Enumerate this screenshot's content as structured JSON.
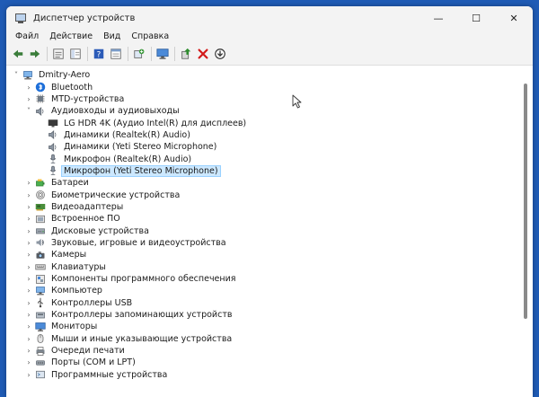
{
  "window": {
    "title": "Диспетчер устройств",
    "controls": {
      "minimize": "—",
      "maximize": "☐",
      "close": "✕"
    }
  },
  "menu": [
    "Файл",
    "Действие",
    "Вид",
    "Справка"
  ],
  "toolbar": [
    {
      "name": "back-button",
      "icon": "arrow-left-icon"
    },
    {
      "name": "forward-button",
      "icon": "arrow-right-icon"
    },
    {
      "sep": true
    },
    {
      "name": "properties-button",
      "icon": "properties-icon"
    },
    {
      "name": "show-hide-console-tree-button",
      "icon": "console-tree-icon"
    },
    {
      "sep": true
    },
    {
      "name": "help-button",
      "icon": "help-icon"
    },
    {
      "name": "driver-details-button",
      "icon": "panel-icon"
    },
    {
      "sep": true
    },
    {
      "name": "scan-hardware-button",
      "icon": "scan-icon"
    },
    {
      "sep": true
    },
    {
      "name": "monitor-button",
      "icon": "monitor-icon"
    },
    {
      "sep": true
    },
    {
      "name": "update-driver-button",
      "icon": "update-driver-icon"
    },
    {
      "name": "uninstall-button",
      "icon": "red-x-icon"
    },
    {
      "name": "disable-device-button",
      "icon": "download-circle-icon"
    }
  ],
  "tree": [
    {
      "label": "Dmitry-Aero",
      "level": 0,
      "exp": "open",
      "icon": "computer-icon"
    },
    {
      "label": "Bluetooth",
      "level": 1,
      "exp": "closed",
      "icon": "bluetooth-icon"
    },
    {
      "label": "MTD-устройства",
      "level": 1,
      "exp": "closed",
      "icon": "chip-icon"
    },
    {
      "label": "Аудиовходы и аудиовыходы",
      "level": 1,
      "exp": "open",
      "icon": "speaker-icon"
    },
    {
      "label": "LG HDR 4K (Аудио Intel(R) для дисплеев)",
      "level": 2,
      "exp": "none",
      "icon": "display-audio-icon"
    },
    {
      "label": "Динамики (Realtek(R) Audio)",
      "level": 2,
      "exp": "none",
      "icon": "speaker-icon"
    },
    {
      "label": "Динамики (Yeti Stereo Microphone)",
      "level": 2,
      "exp": "none",
      "icon": "speaker-icon"
    },
    {
      "label": "Микрофон (Realtek(R) Audio)",
      "level": 2,
      "exp": "none",
      "icon": "microphone-icon"
    },
    {
      "label": "Микрофон (Yeti Stereo Microphone)",
      "level": 2,
      "exp": "none",
      "icon": "microphone-icon",
      "selected": true
    },
    {
      "label": "Батареи",
      "level": 1,
      "exp": "closed",
      "icon": "battery-icon"
    },
    {
      "label": "Биометрические устройства",
      "level": 1,
      "exp": "closed",
      "icon": "fingerprint-icon"
    },
    {
      "label": "Видеоадаптеры",
      "level": 1,
      "exp": "closed",
      "icon": "display-adapter-icon"
    },
    {
      "label": "Встроенное ПО",
      "level": 1,
      "exp": "closed",
      "icon": "firmware-icon"
    },
    {
      "label": "Дисковые устройства",
      "level": 1,
      "exp": "closed",
      "icon": "disk-icon"
    },
    {
      "label": "Звуковые, игровые и видеоустройства",
      "level": 1,
      "exp": "closed",
      "icon": "sound-icon"
    },
    {
      "label": "Камеры",
      "level": 1,
      "exp": "closed",
      "icon": "camera-icon"
    },
    {
      "label": "Клавиатуры",
      "level": 1,
      "exp": "closed",
      "icon": "keyboard-icon"
    },
    {
      "label": "Компоненты программного обеспечения",
      "level": 1,
      "exp": "closed",
      "icon": "software-component-icon"
    },
    {
      "label": "Компьютер",
      "level": 1,
      "exp": "closed",
      "icon": "computer-icon"
    },
    {
      "label": "Контроллеры USB",
      "level": 1,
      "exp": "closed",
      "icon": "usb-icon"
    },
    {
      "label": "Контроллеры запоминающих устройств",
      "level": 1,
      "exp": "closed",
      "icon": "storage-controller-icon"
    },
    {
      "label": "Мониторы",
      "level": 1,
      "exp": "closed",
      "icon": "monitor-icon"
    },
    {
      "label": "Мыши и иные указывающие устройства",
      "level": 1,
      "exp": "closed",
      "icon": "mouse-icon"
    },
    {
      "label": "Очереди печати",
      "level": 1,
      "exp": "closed",
      "icon": "printer-icon"
    },
    {
      "label": "Порты (COM и LPT)",
      "level": 1,
      "exp": "closed",
      "icon": "port-icon"
    },
    {
      "label": "Программные устройства",
      "level": 1,
      "exp": "closed",
      "icon": "software-device-icon"
    }
  ]
}
